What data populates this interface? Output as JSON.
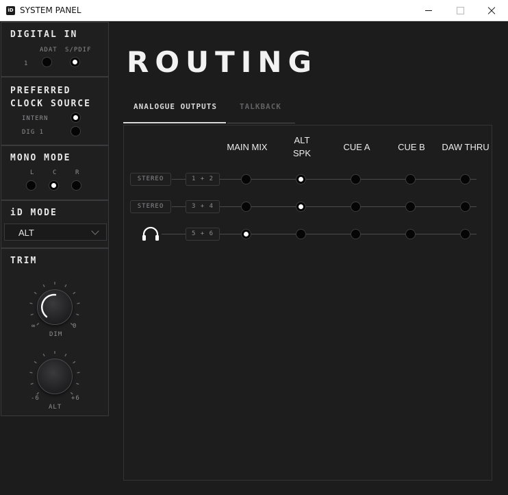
{
  "window": {
    "icon_label": "iD",
    "title": "SYSTEM PANEL",
    "controls": [
      "minimize",
      "maximize",
      "close"
    ]
  },
  "sidebar": {
    "digital_in": {
      "title": "DIGITAL IN",
      "index_label": "1",
      "options": [
        {
          "label": "ADAT",
          "selected": false
        },
        {
          "label": "S/PDIF",
          "selected": true
        }
      ]
    },
    "clock_source": {
      "title_line1": "PREFERRED",
      "title_line2": "CLOCK SOURCE",
      "options": [
        {
          "label": "INTERN",
          "selected": true
        },
        {
          "label": "DIG 1",
          "selected": false
        }
      ]
    },
    "mono_mode": {
      "title": "MONO MODE",
      "options": [
        {
          "label": "L",
          "selected": false
        },
        {
          "label": "C",
          "selected": true
        },
        {
          "label": "R",
          "selected": false
        }
      ]
    },
    "id_mode": {
      "title": "iD MODE",
      "value": "ALT"
    },
    "trim": {
      "title": "TRIM",
      "dim": {
        "label": "DIM",
        "min_label": "∞",
        "max_label": "0"
      },
      "alt": {
        "label": "ALT",
        "min_label": "-6",
        "max_label": "+6"
      }
    }
  },
  "main": {
    "title": "ROUTING",
    "tabs": [
      {
        "label": "ANALOGUE OUTPUTS",
        "active": true
      },
      {
        "label": "TALKBACK",
        "active": false
      }
    ],
    "columns": [
      {
        "line1": "MAIN MIX",
        "line2": ""
      },
      {
        "line1": "ALT",
        "line2": "SPK"
      },
      {
        "line1": "CUE A",
        "line2": ""
      },
      {
        "line1": "CUE B",
        "line2": ""
      },
      {
        "line1": "DAW THRU",
        "line2": ""
      }
    ],
    "rows": [
      {
        "type": "STEREO",
        "icon": "",
        "channels": "1 + 2",
        "selected_column": 1
      },
      {
        "type": "STEREO",
        "icon": "",
        "channels": "3 + 4",
        "selected_column": 1
      },
      {
        "type": "",
        "icon": "headphones-icon",
        "channels": "5 + 6",
        "selected_column": 0
      }
    ]
  },
  "colors": {
    "background": "#1c1c1d",
    "panel_border": "#3a3a3c",
    "led_on": "#ffffff",
    "led_off": "#050505",
    "text_primary": "#ececec",
    "text_dim": "#8e8e90"
  }
}
